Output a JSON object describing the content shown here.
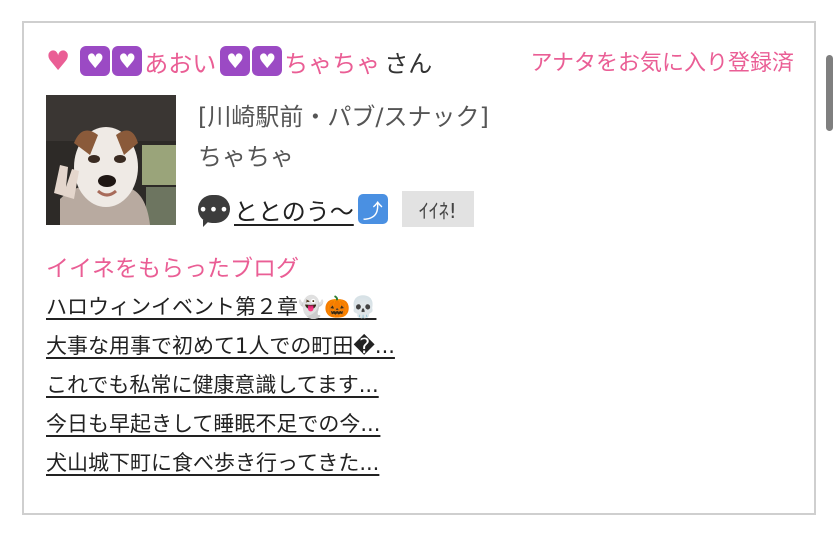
{
  "header": {
    "heart": "♥",
    "name_prefix": "あおい",
    "name_main": "ちゃちゃ",
    "honorific": "さん",
    "favorite_status": "アナタをお気に入り登録済"
  },
  "profile": {
    "shop": "[川崎駅前・パブ/スナック]",
    "cast_name": "ちゃちゃ",
    "comment": "ととのう〜",
    "iine_button": "ｲｲﾈ!"
  },
  "blog": {
    "heading": "イイネをもらったブログ",
    "posts": [
      "ハロウィンイベント第２章👻🎃💀",
      "大事な用事で初めて1人での町田�...",
      "これでも私常に健康意識してます...",
      "今日も早起きして睡眠不足での今...",
      "犬山城下町に食べ歩き行ってきた..."
    ]
  },
  "icons": [
    "heart-icon",
    "purple-heart-icon",
    "speech-bubble-icon",
    "return-arrow-icon"
  ],
  "colors": {
    "accent": "#ea5e95",
    "purple_heart": "#9b4ac4",
    "border": "#cfcfcf"
  }
}
